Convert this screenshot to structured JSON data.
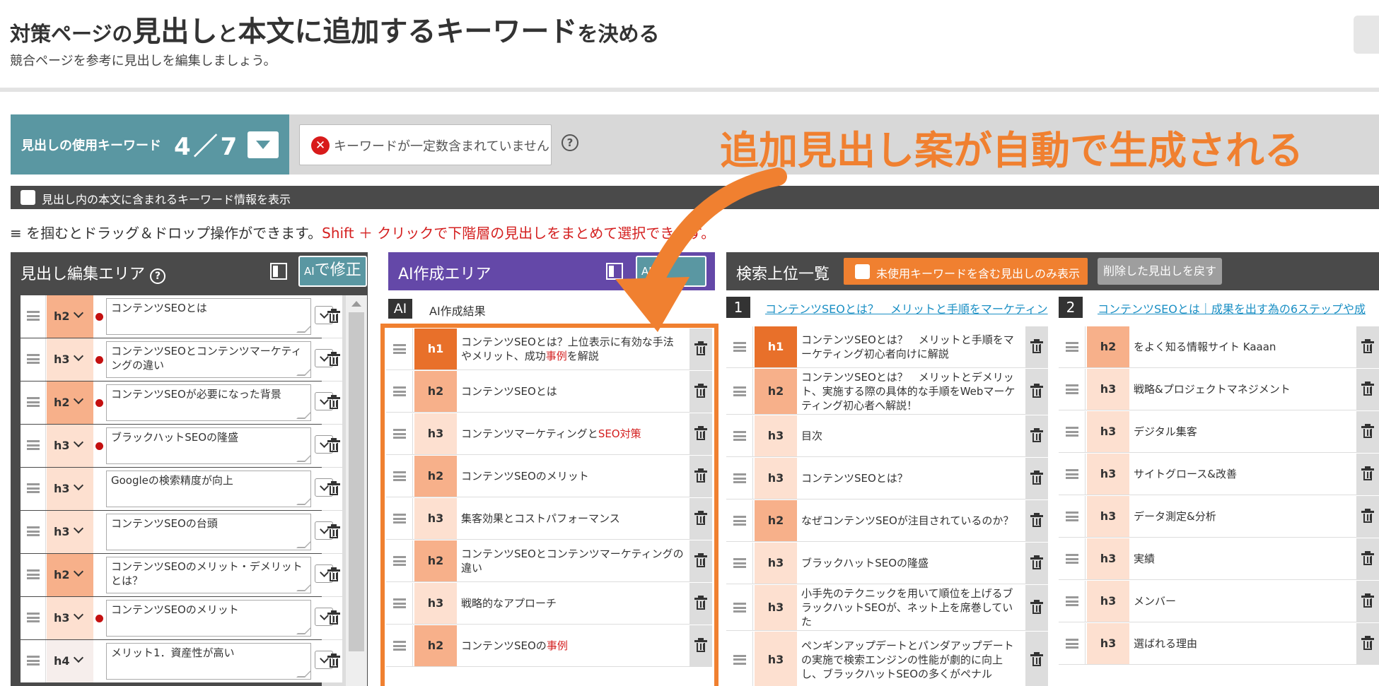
{
  "header": {
    "title_parts": [
      "対策ページの",
      "見出し",
      "と",
      "本文",
      "に",
      "追加する",
      "キーワード",
      "を決める"
    ],
    "subtitle": "競合ページを参考に見出しを編集しましょう。"
  },
  "keyword_bar": {
    "label": "見出しの使用キーワード",
    "count": "4／7",
    "warning": "キーワードが一定数含まれていません",
    "help": "?"
  },
  "promo_text": "追加見出し案が自動で生成される",
  "body_keyword_toggle": "見出し内の本文に含まれるキーワード情報を表示",
  "hint": {
    "glyph": "≡",
    "part1": " を掴むとドラッグ＆ドロップ操作ができます。",
    "part2": "Shift ＋ クリックで下階層の見出しをまとめて選択できます。"
  },
  "edit_area": {
    "title": "見出し編集エリア",
    "help": "?",
    "ai_button_small": "AI",
    "ai_button": "で修正",
    "rows": [
      {
        "level": "h2",
        "text": "コンテンツSEOとは",
        "dot": true
      },
      {
        "level": "h3",
        "text": "コンテンツSEOとコンテンツマーケティングの違い",
        "dot": true
      },
      {
        "level": "h2",
        "text": "コンテンツSEOが必要になった背景",
        "dot": true
      },
      {
        "level": "h3",
        "text": "ブラックハットSEOの隆盛",
        "dot": true
      },
      {
        "level": "h3",
        "text": "Googleの検索精度が向上",
        "dot": false
      },
      {
        "level": "h3",
        "text": "コンテンツSEOの台頭",
        "dot": false
      },
      {
        "level": "h2",
        "text": "コンテンツSEOのメリット・デメリットとは？",
        "dot": false
      },
      {
        "level": "h3",
        "text": "コンテンツSEOのメリット",
        "dot": true
      },
      {
        "level": "h4",
        "text": "メリット1．資産性が高い",
        "dot": false
      }
    ]
  },
  "ai_area": {
    "title": "AI作成エリア",
    "ai_button_small": "AI",
    "result_label": "AI",
    "result_text": "AI作成結果",
    "rows": [
      {
        "level": "h1",
        "text": "コンテンツSEOとは？上位表示に有効な手法やメリット、成功",
        "red": "事例",
        "after": "を解説"
      },
      {
        "level": "h2",
        "text": "コンテンツSEOとは",
        "red": "",
        "after": ""
      },
      {
        "level": "h3",
        "text": "コンテンツマーケティングと",
        "red": "SEO対策",
        "after": ""
      },
      {
        "level": "h2",
        "text": "コンテンツSEOのメリット",
        "red": "",
        "after": ""
      },
      {
        "level": "h3",
        "text": "集客効果とコストパフォーマンス",
        "red": "",
        "after": ""
      },
      {
        "level": "h2",
        "text": "コンテンツSEOとコンテンツマーケティングの違い",
        "red": "",
        "after": ""
      },
      {
        "level": "h3",
        "text": "戦略的なアプローチ",
        "red": "",
        "after": ""
      },
      {
        "level": "h2",
        "text": "コンテンツSEOの",
        "red": "事例",
        "after": ""
      }
    ]
  },
  "search_top": {
    "title": "検索上位一覧",
    "unused_only": "未使用キーワードを含む見出しのみ表示",
    "restore": "削除した見出しを戻す",
    "columns": [
      {
        "rank": "1",
        "link": "コンテンツSEOとは？　メリットと手順をマーケティン",
        "rows": [
          {
            "level": "h1",
            "text": "コンテンツSEOとは？　メリットと手順をマーケティング初心者向けに解説"
          },
          {
            "level": "h2",
            "text": "コンテンツSEOとは？　メリットとデメリット、実施する際の具体的な手順をWebマーケティング初心者へ解説！"
          },
          {
            "level": "h3",
            "text": "目次"
          },
          {
            "level": "h3",
            "text": "コンテンツSEOとは？"
          },
          {
            "level": "h2",
            "text": "なぜコンテンツSEOが注目されているのか？"
          },
          {
            "level": "h3",
            "text": "ブラックハットSEOの隆盛"
          },
          {
            "level": "h3",
            "text": "小手先のテクニックを用いて順位を上げるブラックハットSEOが、ネット上を席巻していた"
          },
          {
            "level": "h3",
            "text": "ペンギンアップデートとパンダアップデートの実施で検索エンジンの性能が劇的に向上し、ブラックハットSEOの多くがペナル"
          }
        ]
      },
      {
        "rank": "2",
        "link": "コンテンツSEOとは｜成果を出す為の6ステップや成",
        "rows": [
          {
            "level": "h2",
            "text": "をよく知る情報サイト Kaaan"
          },
          {
            "level": "h3",
            "text": "戦略&プロジェクトマネジメント"
          },
          {
            "level": "h3",
            "text": "デジタル集客"
          },
          {
            "level": "h3",
            "text": "サイトグロース&改善"
          },
          {
            "level": "h3",
            "text": "データ測定&分析"
          },
          {
            "level": "h3",
            "text": "実績"
          },
          {
            "level": "h3",
            "text": "メンバー"
          },
          {
            "level": "h3",
            "text": "選ばれる理由"
          }
        ]
      }
    ]
  },
  "colors": {
    "teal": "#5a97a2",
    "orange": "#f08030",
    "purple": "#6448a8",
    "h1": "#e8702a",
    "h2": "#f7b08a",
    "h3": "#fde0d0"
  }
}
